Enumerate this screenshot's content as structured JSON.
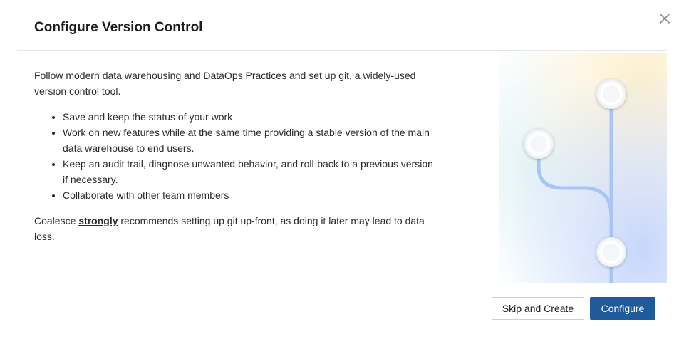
{
  "dialog": {
    "title": "Configure Version Control",
    "close_icon": "close-icon",
    "intro": "Follow modern data warehousing and DataOps Practices and set up git, a widely-used version control tool.",
    "bullets": [
      "Save and keep the status of your work",
      "Work on new features while at the same time providing a stable version of the main data warehouse to end users.",
      "Keep an audit trail, diagnose unwanted behavior, and roll-back to a previous version if necessary.",
      "Collaborate with other team members"
    ],
    "recommend_prefix": "Coalesce ",
    "recommend_emphasis": "strongly",
    "recommend_suffix": " recommends setting up git up-front, as doing it later may lead to data loss.",
    "illustration_icon": "git-branch-illustration",
    "buttons": {
      "skip_label": "Skip and Create",
      "configure_label": "Configure"
    },
    "colors": {
      "primary": "#1f5a9a",
      "branch_line": "#a9c4f5"
    }
  }
}
